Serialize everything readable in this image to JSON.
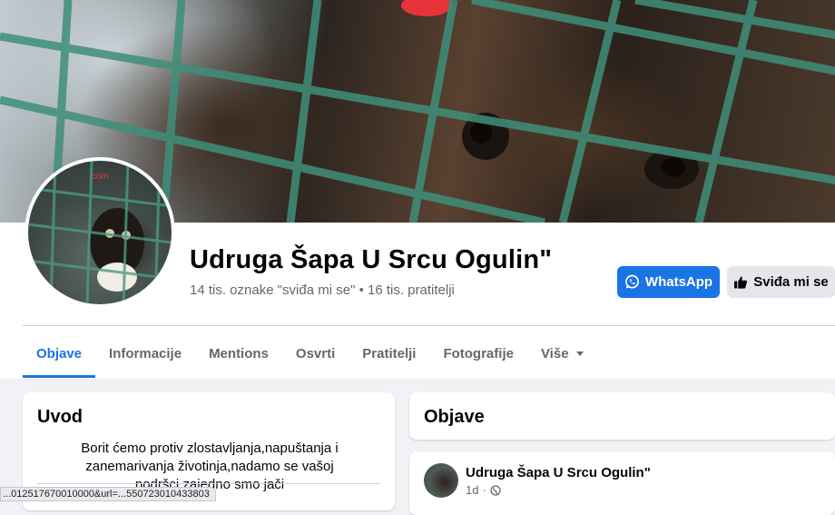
{
  "page": {
    "name": "Udruga Šapa U Srcu Ogulin\"",
    "stats": "14 tis. oznake \"sviđa mi se\" • 16 tis. pratitelji",
    "avatar_watermark": "com"
  },
  "actions": {
    "whatsapp_label": "WhatsApp",
    "like_label": "Sviđa mi se"
  },
  "tabs": [
    {
      "label": "Objave",
      "active": true
    },
    {
      "label": "Informacije"
    },
    {
      "label": "Mentions"
    },
    {
      "label": "Osvrti"
    },
    {
      "label": "Pratitelji"
    },
    {
      "label": "Fotografije"
    },
    {
      "label": "Više"
    }
  ],
  "intro": {
    "title": "Uvod",
    "text": "Borit ćemo protiv zlostavljanja,napuštanja i zanemarivanja životinja,nadamo se vašoj podršci,zajedno smo jači"
  },
  "posts": {
    "title": "Objave",
    "first": {
      "author": "Udruga Šapa U Srcu Ogulin\"",
      "time": "1d",
      "privacy_icon": "globe-icon"
    }
  },
  "status_url": "...012517670010000&url=...550723010433803",
  "colors": {
    "accent": "#1b74e4",
    "background": "#f0f2f5",
    "secondary_text": "#65676b"
  }
}
